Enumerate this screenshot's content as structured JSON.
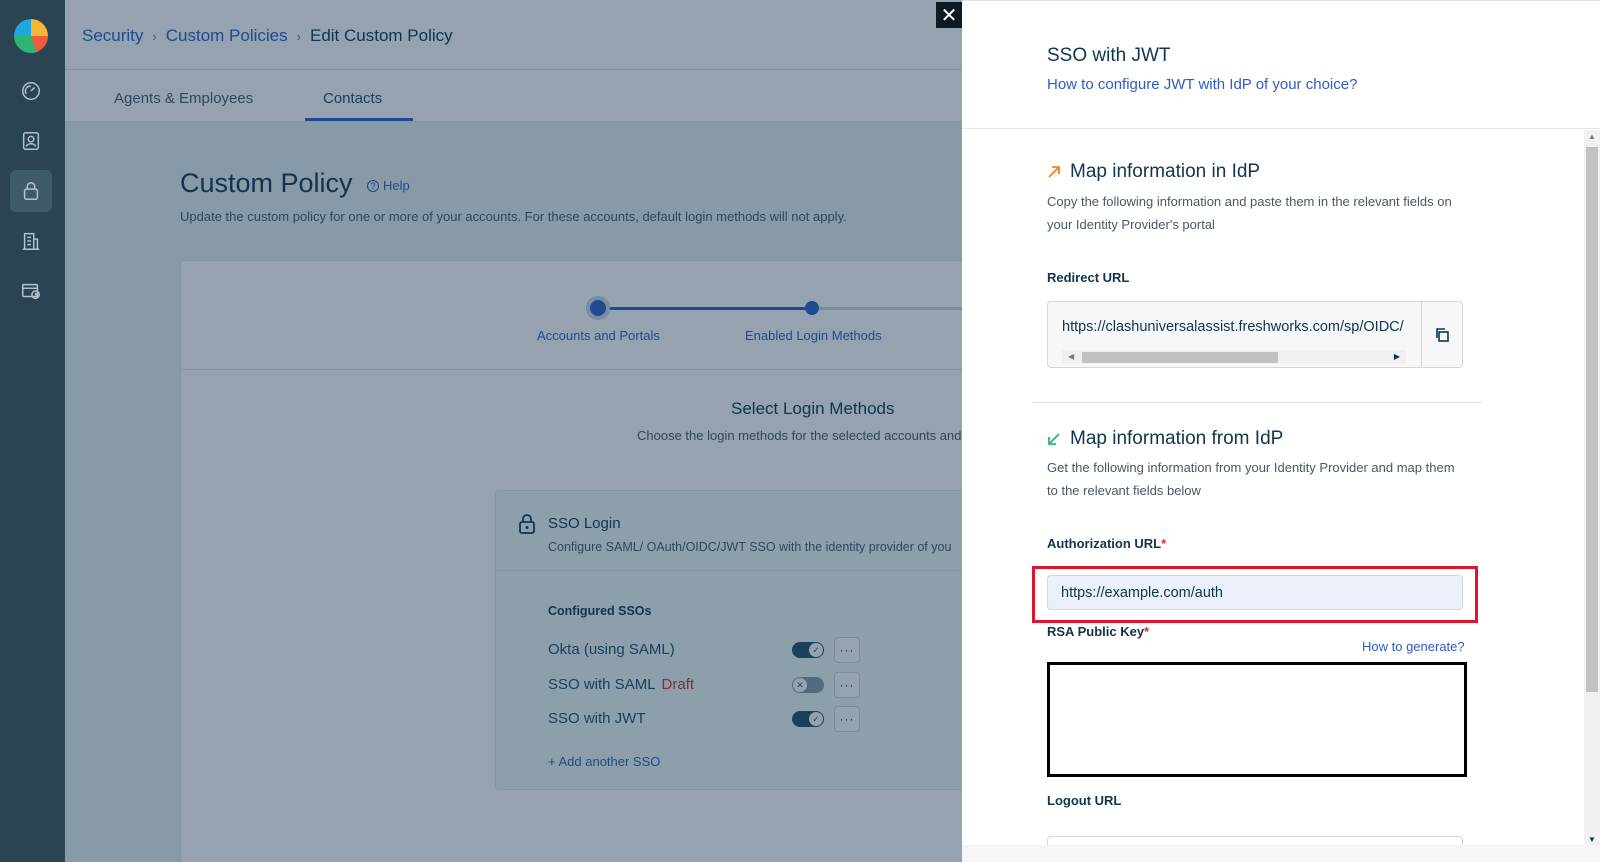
{
  "breadcrumb": {
    "security": "Security",
    "custom_policies": "Custom Policies",
    "current": "Edit Custom Policy",
    "separator": "›"
  },
  "tabs": [
    {
      "label": "Agents & Employees"
    },
    {
      "label": "Contacts",
      "active": true
    }
  ],
  "page": {
    "title": "Custom Policy",
    "help": "Help",
    "description": "Update the custom policy for one or more of your accounts. For these accounts, default login methods will not apply."
  },
  "stepper": {
    "steps": [
      {
        "label": "Accounts and Portals"
      },
      {
        "label": "Enabled Login Methods"
      }
    ]
  },
  "login_methods": {
    "title": "Select Login Methods",
    "description": "Choose the login methods for the selected accounts and",
    "sso": {
      "title": "SSO Login",
      "description": "Configure SAML/ OAuth/OIDC/JWT SSO with the identity provider of you",
      "configured_label": "Configured SSOs",
      "items": [
        {
          "name": "Okta (using SAML)",
          "draft": "",
          "enabled": true
        },
        {
          "name": "SSO with SAML",
          "draft": "Draft",
          "enabled": false
        },
        {
          "name": "SSO with JWT",
          "draft": "",
          "enabled": true
        }
      ],
      "more_label": "···",
      "add_label": "+ Add another SSO"
    }
  },
  "drawer": {
    "close_label": "✕",
    "title": "SSO with JWT",
    "help_link": "How to configure JWT with IdP of your choice?",
    "map_in": {
      "title": "Map information in IdP",
      "description": "Copy the following information and paste them in the relevant fields on your Identity Provider's portal",
      "redirect_label": "Redirect URL",
      "redirect_url": "https://clashuniversalassist.freshworks.com/sp/OIDC/"
    },
    "map_from": {
      "title": "Map information from IdP",
      "description": "Get the following information from your Identity Provider and map them to the relevant fields below",
      "auth_label": "Authorization URL",
      "auth_value": "https://example.com/auth",
      "rsa_label": "RSA Public Key",
      "how_to_generate": "How to generate?",
      "rsa_value": "",
      "logout_label": "Logout URL",
      "required_mark": "*"
    }
  },
  "colors": {
    "accent": "#2c5cc5",
    "sidebar": "#2a4453",
    "highlight": "#e0142c",
    "required": "#d72d30"
  }
}
